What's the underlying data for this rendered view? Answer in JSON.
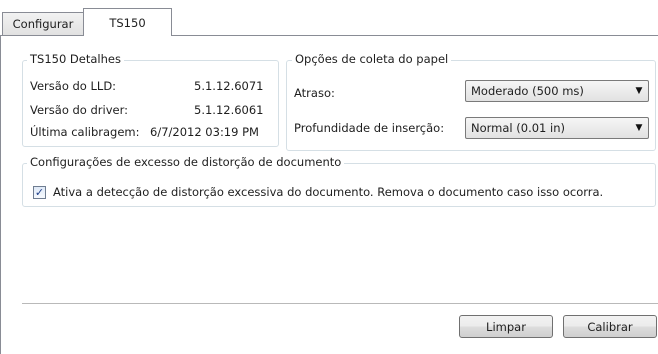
{
  "tabs": [
    {
      "label": "Configurar",
      "active": false
    },
    {
      "label": "TS150",
      "active": true
    }
  ],
  "details": {
    "legend": "TS150 Detalhes",
    "lld_label": "Versão do LLD:",
    "lld_value": "5.1.12.6071",
    "driver_label": "Versão do driver:",
    "driver_value": "5.1.12.6061",
    "calibration_label": "Última calibragem:",
    "calibration_value": "6/7/2012  03:19 PM"
  },
  "paper": {
    "legend": "Opções de coleta do papel",
    "delay_label": "Atraso:",
    "delay_value": "Moderado (500 ms)",
    "depth_label": "Profundidade de inserção:",
    "depth_value": "Normal (0.01 in)"
  },
  "skew": {
    "legend": "Configurações de excesso de distorção de documento",
    "checkbox_label": "Ativa a detecção de distorção excessiva do documento. Remova o documento caso isso ocorra.",
    "checked": true
  },
  "buttons": {
    "clear": "Limpar",
    "calibrate": "Calibrar"
  },
  "icons": {
    "dropdown": "▼",
    "check": "✓"
  }
}
